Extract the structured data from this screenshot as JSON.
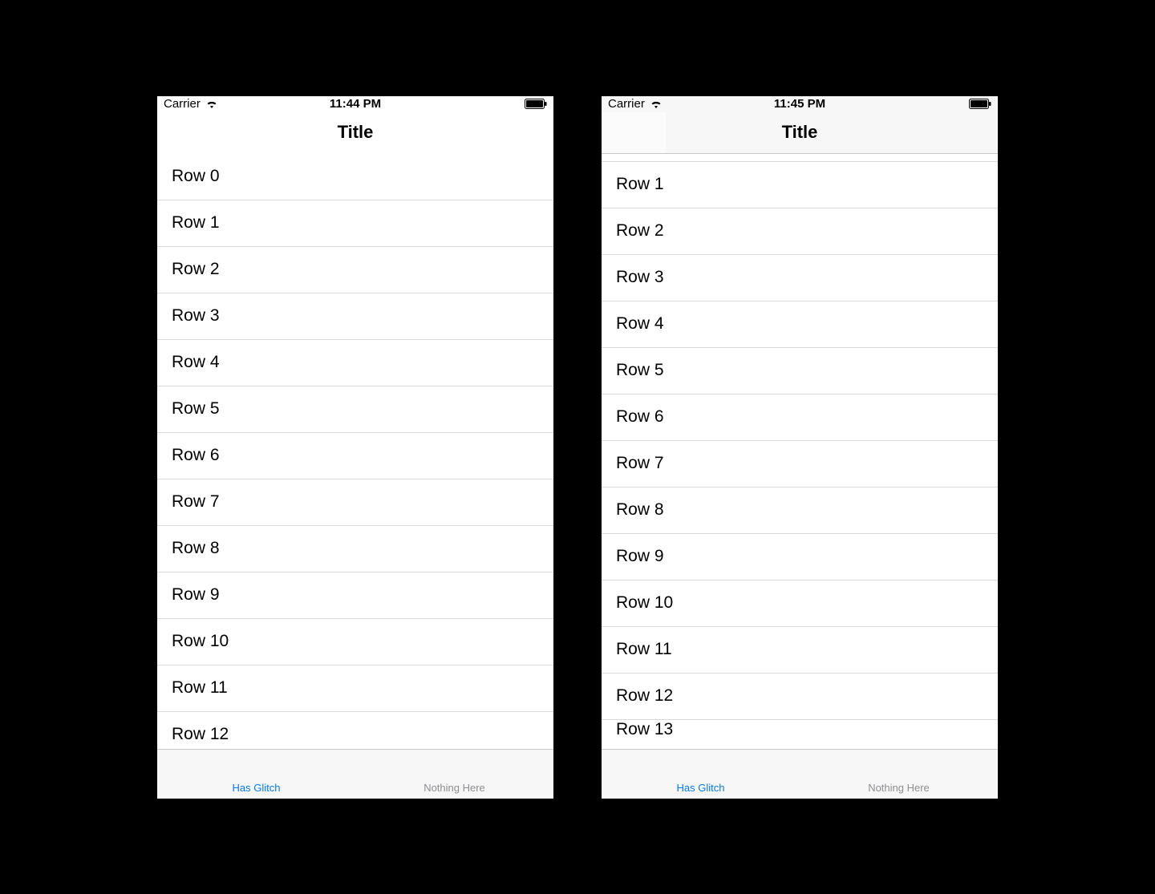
{
  "left": {
    "status": {
      "carrier": "Carrier",
      "time": "11:44 PM"
    },
    "nav": {
      "title": "Title",
      "opaque": false
    },
    "rows": [
      "Row 0",
      "Row 1",
      "Row 2",
      "Row 3",
      "Row 4",
      "Row 5",
      "Row 6",
      "Row 7",
      "Row 8",
      "Row 9",
      "Row 10",
      "Row 11",
      "Row 12"
    ],
    "tabs": {
      "active": "Has Glitch",
      "inactive": "Nothing Here"
    }
  },
  "right": {
    "status": {
      "carrier": "Carrier",
      "time": "11:45 PM"
    },
    "nav": {
      "title": "Title",
      "opaque": true
    },
    "rows": [
      "Row 1",
      "Row 2",
      "Row 3",
      "Row 4",
      "Row 5",
      "Row 6",
      "Row 7",
      "Row 8",
      "Row 9",
      "Row 10",
      "Row 11",
      "Row 12",
      "Row 13"
    ],
    "tabs": {
      "active": "Has Glitch",
      "inactive": "Nothing Here"
    }
  },
  "icons": {
    "wifi": "wifi-icon",
    "battery": "battery-icon"
  },
  "colors": {
    "tint": "#007aff",
    "inactive": "#8e8e93",
    "separator": "#d9d9d9",
    "barBg": "#f7f7f7"
  }
}
